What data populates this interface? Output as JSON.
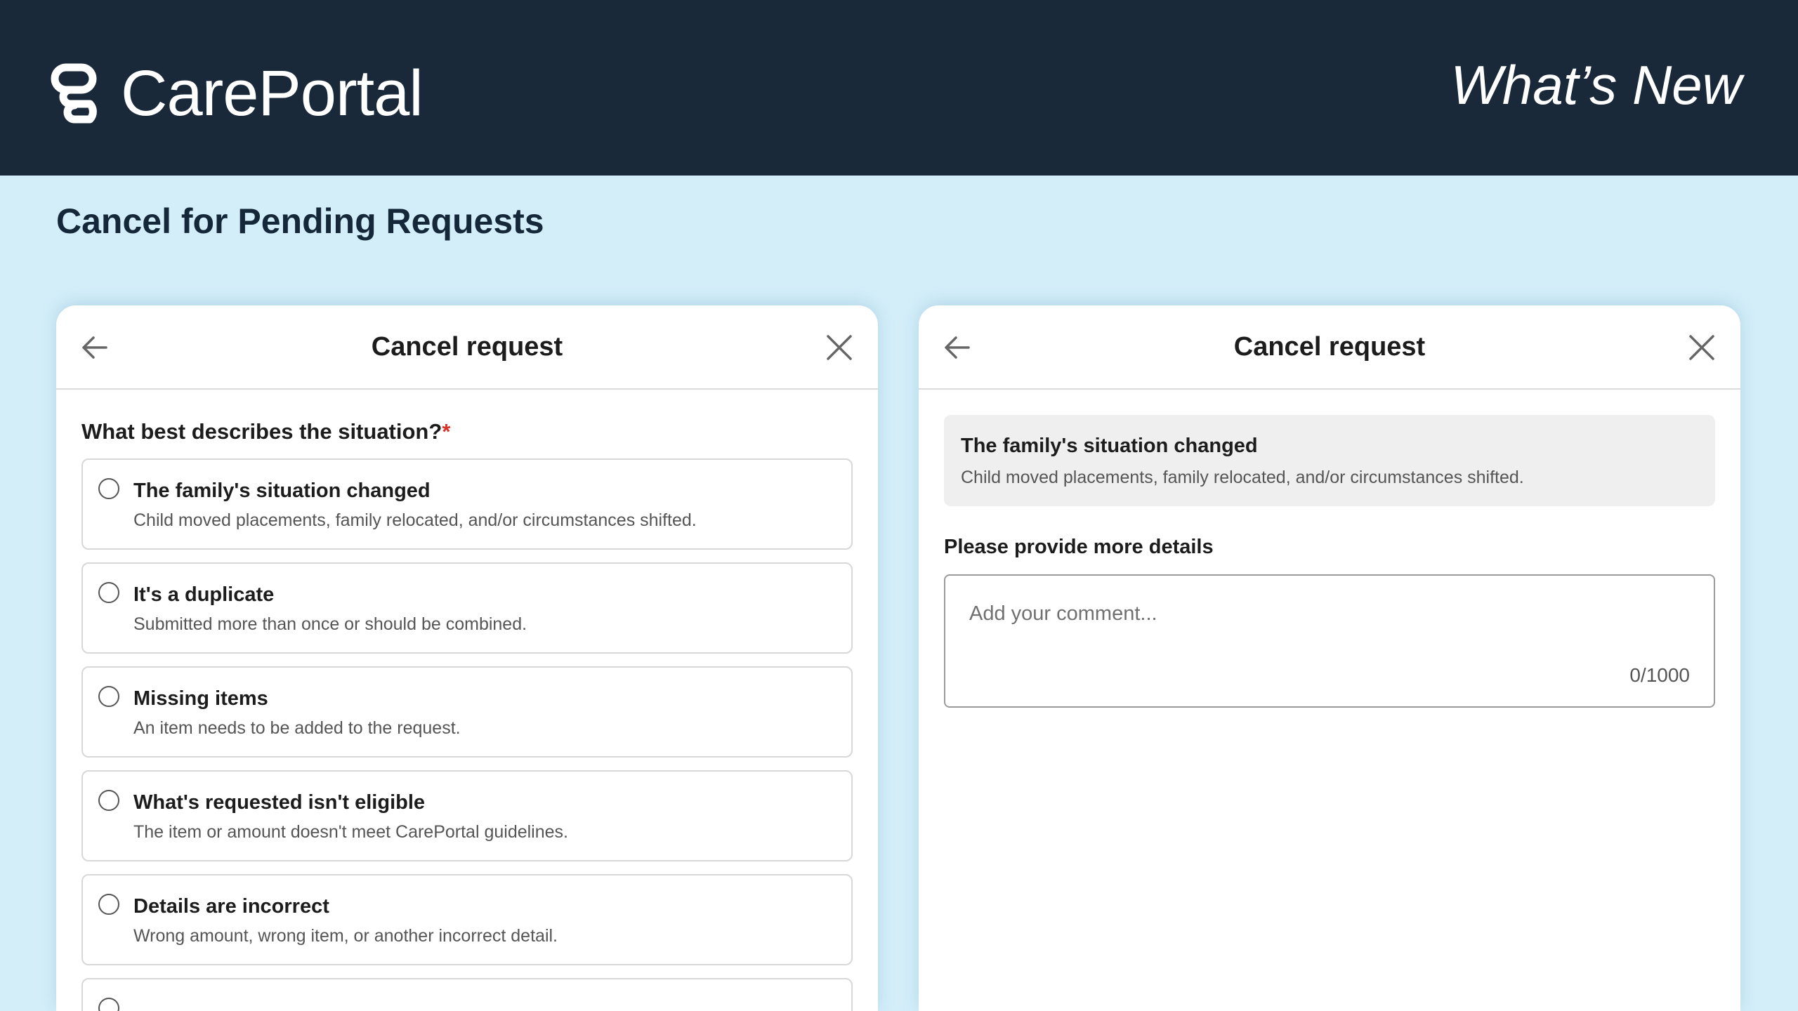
{
  "header": {
    "brand_name": "CarePortal",
    "whats_new": "What’s New",
    "colors": {
      "background": "#1a2939",
      "text": "#ffffff"
    }
  },
  "page": {
    "title": "Cancel for Pending Requests",
    "background": "#d3eef9"
  },
  "left_panel": {
    "title": "Cancel request",
    "back_icon": "arrow-left-icon",
    "close_icon": "close-icon",
    "question": "What best describes the situation?",
    "required_marker": "*",
    "options": [
      {
        "title": "The family's situation changed",
        "description": "Child moved placements, family relocated, and/or circumstances shifted."
      },
      {
        "title": "It's a duplicate",
        "description": "Submitted more than once or should be combined."
      },
      {
        "title": "Missing items",
        "description": "An item needs to be added to the request."
      },
      {
        "title": "What's requested isn't eligible",
        "description": "The item or amount doesn't meet CarePortal guidelines."
      },
      {
        "title": "Details are incorrect",
        "description": "Wrong amount, wrong item, or another incorrect detail."
      }
    ]
  },
  "right_panel": {
    "title": "Cancel request",
    "back_icon": "arrow-left-icon",
    "close_icon": "close-icon",
    "selected_reason": {
      "title": "The family's situation changed",
      "description": "Child moved placements, family relocated, and/or circumstances shifted."
    },
    "details_label": "Please provide more details",
    "comment": {
      "value": "",
      "placeholder": "Add your comment...",
      "counter": "0/1000"
    }
  }
}
